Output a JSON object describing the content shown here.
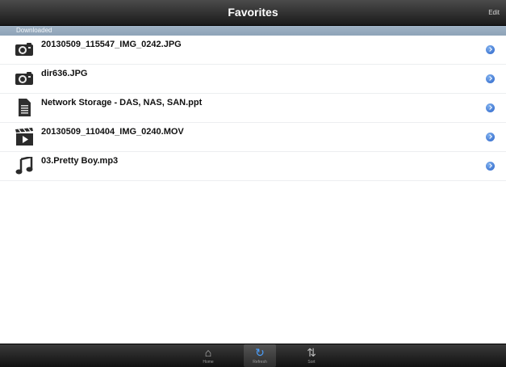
{
  "header": {
    "title": "Favorites",
    "edit_label": "Edit"
  },
  "section": {
    "title": "Downloaded"
  },
  "items": [
    {
      "name": "20130509_115547_IMG_0242.JPG",
      "meta": "",
      "icon": "camera-icon"
    },
    {
      "name": "dir636.JPG",
      "meta": "",
      "icon": "camera-icon"
    },
    {
      "name": "Network Storage - DAS, NAS, SAN.ppt",
      "meta": "",
      "icon": "document-icon"
    },
    {
      "name": "20130509_110404_IMG_0240.MOV",
      "meta": "",
      "icon": "video-icon"
    },
    {
      "name": "03.Pretty Boy.mp3",
      "meta": "",
      "icon": "music-icon"
    }
  ],
  "tabbar": {
    "tabs": [
      {
        "label": "Home",
        "icon": "home-icon"
      },
      {
        "label": "Refresh",
        "icon": "refresh-icon"
      },
      {
        "label": "Sort",
        "icon": "sort-icon"
      }
    ]
  },
  "colors": {
    "accent": "#2a63c9",
    "header_bg": "#8ea3b8"
  }
}
